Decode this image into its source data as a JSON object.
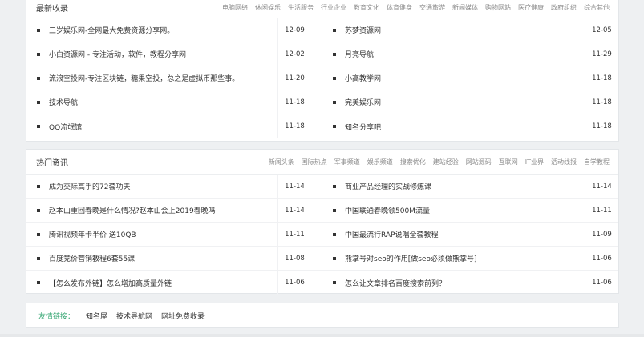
{
  "latest": {
    "title": "最新收录",
    "tabs": [
      "电脑网络",
      "休闲娱乐",
      "生活服务",
      "行业企业",
      "教育文化",
      "体育健身",
      "交通旅游",
      "新闻媒体",
      "购物网站",
      "医疗健康",
      "政府组织",
      "综合其他"
    ],
    "left": [
      {
        "title": "三岁娱乐网-全网最大免费资源分享网。",
        "date": "12-09"
      },
      {
        "title": "小白资源网 - 专注活动，软件，教程分享网",
        "date": "12-02"
      },
      {
        "title": "流浪空投网-专注区块链，糖果空投，总之是虚拟币那些事。",
        "date": "11-20"
      },
      {
        "title": "技术导航",
        "date": "11-18"
      },
      {
        "title": "QQ流氓馆",
        "date": "11-18"
      }
    ],
    "right": [
      {
        "title": "苏梦资源网",
        "date": "12-05"
      },
      {
        "title": "月亮导航",
        "date": "11-29"
      },
      {
        "title": "小高教学网",
        "date": "11-18"
      },
      {
        "title": "完美娱乐网",
        "date": "11-18"
      },
      {
        "title": "知名分享吧",
        "date": "11-18"
      }
    ]
  },
  "hot": {
    "title": "热门资讯",
    "tabs": [
      "新闻头条",
      "国际热点",
      "军事频道",
      "娱乐频道",
      "搜索优化",
      "建站经验",
      "网站源码",
      "互联网",
      "IT业界",
      "活动线报",
      "自学教程"
    ],
    "left": [
      {
        "title": "成为交际高手的72套功夫",
        "date": "11-14"
      },
      {
        "title": "赵本山重回春晚是什么情况?赵本山会上2019春晚吗",
        "date": "11-14"
      },
      {
        "title": "腾讯视频年卡半价 送10QB",
        "date": "11-11"
      },
      {
        "title": "百度竞价营销教程6套55课",
        "date": "11-08"
      },
      {
        "title": "【怎么发布外链】怎么增加高质量外链",
        "date": "11-06"
      }
    ],
    "right": [
      {
        "title": "商业产品经理的实战修炼课",
        "date": "11-14"
      },
      {
        "title": "中国联通春晚领500M流量",
        "date": "11-11"
      },
      {
        "title": "中国最流行RAP说唱全套教程",
        "date": "11-09"
      },
      {
        "title": "熊掌号对seo的作用[做seo必须做熊掌号]",
        "date": "11-06"
      },
      {
        "title": "怎么让文章排名百度搜索前列？",
        "date": "11-06"
      }
    ]
  },
  "friend_links": {
    "label": "友情链接：",
    "items": [
      "知名屋",
      "技术导航网",
      "网址免费收录"
    ],
    "label_color": "#3aa876"
  }
}
